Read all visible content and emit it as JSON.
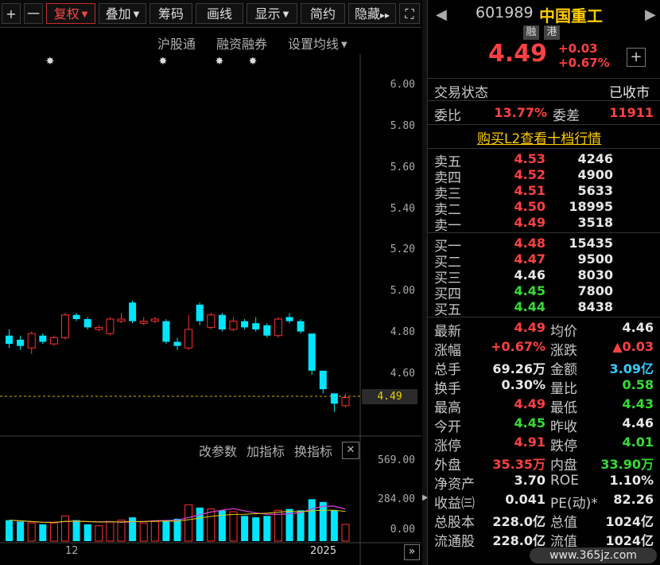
{
  "toolbar": {
    "plus": "+",
    "minus": "一",
    "fuquan": "复权",
    "diejia": "叠加",
    "chouma": "筹码",
    "huaxian": "画线",
    "xianshi": "显示",
    "jianjie": "简约",
    "yincang": "隐藏",
    "arrows": "▸▸",
    "expand": "⛶"
  },
  "chart": {
    "menu_hugutong": "沪股通",
    "menu_rongzi": "融资融券",
    "menu_set_ma": "设置均线",
    "price_labels": [
      "6.00",
      "5.80",
      "5.60",
      "5.40",
      "5.20",
      "5.00",
      "4.80",
      "4.60"
    ],
    "current_price_tag": "4.49",
    "sub_menu_params": "改参数",
    "sub_menu_add": "加指标",
    "sub_menu_switch": "换指标",
    "close_x": "✕",
    "vol_labels": [
      "569.00",
      "284.00",
      "0.00"
    ],
    "x_labels": [
      "12",
      "2025"
    ],
    "nav_arrow": "»",
    "colors": {
      "up": "#ff3030",
      "down": "#00e5ff",
      "dash": "#d4b000"
    }
  },
  "chart_data": {
    "type": "candlestick",
    "candles": [
      {
        "o": 4.79,
        "c": 4.75,
        "h": 4.82,
        "l": 4.73
      },
      {
        "o": 4.77,
        "c": 4.74,
        "h": 4.79,
        "l": 4.72
      },
      {
        "o": 4.73,
        "c": 4.8,
        "h": 4.81,
        "l": 4.7
      },
      {
        "o": 4.79,
        "c": 4.76,
        "h": 4.8,
        "l": 4.75
      },
      {
        "o": 4.75,
        "c": 4.78,
        "h": 4.79,
        "l": 4.74
      },
      {
        "o": 4.78,
        "c": 4.89,
        "h": 4.9,
        "l": 4.77
      },
      {
        "o": 4.89,
        "c": 4.87,
        "h": 4.9,
        "l": 4.86
      },
      {
        "o": 4.87,
        "c": 4.83,
        "h": 4.88,
        "l": 4.82
      },
      {
        "o": 4.82,
        "c": 4.83,
        "h": 4.84,
        "l": 4.81
      },
      {
        "o": 4.8,
        "c": 4.87,
        "h": 4.88,
        "l": 4.79
      },
      {
        "o": 4.86,
        "c": 4.87,
        "h": 4.9,
        "l": 4.85
      },
      {
        "o": 4.95,
        "c": 4.86,
        "h": 4.96,
        "l": 4.85
      },
      {
        "o": 4.85,
        "c": 4.86,
        "h": 4.88,
        "l": 4.84
      },
      {
        "o": 4.86,
        "c": 4.87,
        "h": 4.88,
        "l": 4.85
      },
      {
        "o": 4.86,
        "c": 4.76,
        "h": 4.87,
        "l": 4.75
      },
      {
        "o": 4.76,
        "c": 4.74,
        "h": 4.78,
        "l": 4.72
      },
      {
        "o": 4.73,
        "c": 4.82,
        "h": 4.89,
        "l": 4.72
      },
      {
        "o": 4.94,
        "c": 4.86,
        "h": 4.95,
        "l": 4.84
      },
      {
        "o": 4.83,
        "c": 4.89,
        "h": 4.9,
        "l": 4.82
      },
      {
        "o": 4.89,
        "c": 4.82,
        "h": 4.9,
        "l": 4.81
      },
      {
        "o": 4.82,
        "c": 4.86,
        "h": 4.88,
        "l": 4.81
      },
      {
        "o": 4.86,
        "c": 4.83,
        "h": 4.87,
        "l": 4.82
      },
      {
        "o": 4.85,
        "c": 4.82,
        "h": 4.88,
        "l": 4.81
      },
      {
        "o": 4.84,
        "c": 4.79,
        "h": 4.85,
        "l": 4.78
      },
      {
        "o": 4.79,
        "c": 4.87,
        "h": 4.88,
        "l": 4.78
      },
      {
        "o": 4.88,
        "c": 4.86,
        "h": 4.9,
        "l": 4.85
      },
      {
        "o": 4.86,
        "c": 4.81,
        "h": 4.87,
        "l": 4.8
      },
      {
        "o": 4.8,
        "c": 4.62,
        "h": 4.8,
        "l": 4.6
      },
      {
        "o": 4.62,
        "c": 4.53,
        "h": 4.62,
        "l": 4.51
      },
      {
        "o": 4.51,
        "c": 4.46,
        "h": 4.51,
        "l": 4.42
      },
      {
        "o": 4.45,
        "c": 4.49,
        "h": 4.51,
        "l": 4.44
      }
    ],
    "volumes": [
      150,
      140,
      130,
      120,
      130,
      180,
      150,
      120,
      110,
      140,
      150,
      170,
      130,
      140,
      150,
      160,
      260,
      240,
      230,
      220,
      210,
      180,
      170,
      180,
      220,
      230,
      220,
      300,
      280,
      220,
      120
    ],
    "y_range": [
      4.4,
      6.0
    ],
    "vol_range": [
      0,
      569
    ]
  },
  "panel": {
    "code": "601989",
    "name": "中国重工",
    "badge_rong": "融",
    "badge_gang": "港",
    "price": "4.49",
    "change": "+0.03",
    "change_pct": "+0.67%",
    "add": "+",
    "status_label": "交易状态",
    "status_value": "已收市",
    "weibi_label": "委比",
    "weibi_value": "13.77%",
    "weicha_label": "委差",
    "weicha_value": "11911",
    "l2_link": "购买L2查看十档行情",
    "asks": [
      {
        "label": "卖五",
        "price": "4.53",
        "vol": "4246"
      },
      {
        "label": "卖四",
        "price": "4.52",
        "vol": "4900"
      },
      {
        "label": "卖三",
        "price": "4.51",
        "vol": "5633"
      },
      {
        "label": "卖二",
        "price": "4.50",
        "vol": "18995"
      },
      {
        "label": "卖一",
        "price": "4.49",
        "vol": "3518"
      }
    ],
    "bids": [
      {
        "label": "买一",
        "price": "4.48",
        "vol": "15435"
      },
      {
        "label": "买二",
        "price": "4.47",
        "vol": "9500"
      },
      {
        "label": "买三",
        "price": "4.46",
        "vol": "8030"
      },
      {
        "label": "买四",
        "price": "4.45",
        "vol": "7800"
      },
      {
        "label": "买五",
        "price": "4.44",
        "vol": "8438"
      }
    ],
    "stats": [
      {
        "l1": "最新",
        "v1": "4.49",
        "c1": "red",
        "l2": "均价",
        "v2": "4.46",
        "c2": "white"
      },
      {
        "l1": "涨幅",
        "v1": "+0.67%",
        "c1": "red",
        "l2": "涨跌",
        "v2": "▲0.03",
        "c2": "red"
      },
      {
        "l1": "总手",
        "v1": "69.26万",
        "c1": "white",
        "l2": "金额",
        "v2": "3.09亿",
        "c2": "cyan"
      },
      {
        "l1": "换手",
        "v1": "0.30%",
        "c1": "white",
        "l2": "量比",
        "v2": "0.58",
        "c2": "green"
      },
      {
        "l1": "最高",
        "v1": "4.49",
        "c1": "red",
        "l2": "最低",
        "v2": "4.43",
        "c2": "green"
      },
      {
        "l1": "今开",
        "v1": "4.45",
        "c1": "green",
        "l2": "昨收",
        "v2": "4.46",
        "c2": "white"
      },
      {
        "l1": "涨停",
        "v1": "4.91",
        "c1": "red",
        "l2": "跌停",
        "v2": "4.01",
        "c2": "green"
      },
      {
        "l1": "外盘",
        "v1": "35.35万",
        "c1": "red",
        "l2": "内盘",
        "v2": "33.90万",
        "c2": "green"
      },
      {
        "l1": "净资产",
        "v1": "3.70",
        "c1": "white",
        "l2": "ROE",
        "v2": "1.10%",
        "c2": "white"
      },
      {
        "l1": "收益㈢",
        "v1": "0.041",
        "c1": "white",
        "l2": "PE(动)*",
        "v2": "82.26",
        "c2": "white"
      },
      {
        "l1": "总股本",
        "v1": "228.0亿",
        "c1": "white",
        "l2": "总值",
        "v2": "1024亿",
        "c2": "white"
      },
      {
        "l1": "流通股",
        "v1": "228.0亿",
        "c1": "white",
        "l2": "流值",
        "v2": "1024亿",
        "c2": "white"
      }
    ],
    "watermark": "www.365jz.com"
  }
}
